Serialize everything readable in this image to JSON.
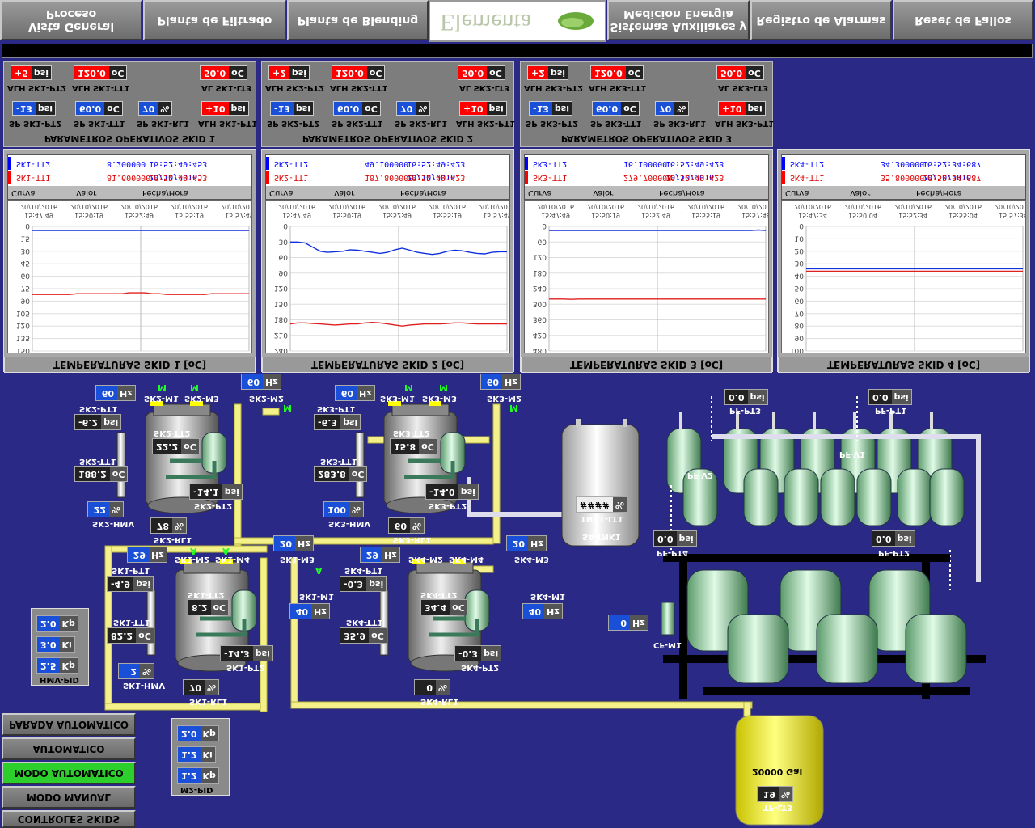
{
  "nav": {
    "items": [
      "Vista General Proceso",
      "Planta de Filtrado",
      "Planta de Blending",
      "Sistemas Auxiliares y Medicion Energia",
      "Registro de Alarmas",
      "Reset de Fallos"
    ],
    "logo_text": "Elementa"
  },
  "skids_params": [
    {
      "title": "PARAMETROS OPERATIVOS SKID 1",
      "alh_pt2": "+5",
      "alh_pt2_u": "psi",
      "alh_tt1": "120.0",
      "alh_tt1_u": "oC",
      "al_lt3": "50.0",
      "al_lt3_u": "oC",
      "lbl_alh_pt2": "ALH SK1-PT2",
      "lbl_alh_tt1": "ALH SK1-TT1",
      "lbl_al_lt3": "AL SK1-LT3",
      "sp_pt2": "-13",
      "sp_pt2_u": "psi",
      "sp_tt1": "60.0",
      "sp_tt1_u": "oC",
      "sp_rl1": "70",
      "sp_rl1_u": "%",
      "alh_pt1": "+10",
      "alh_pt1_u": "psi",
      "lbl_sp_pt2": "SP SK1-PT2",
      "lbl_sp_tt1": "SP SK1-TT1",
      "lbl_sp_rl1": "SP SK1-RL1",
      "lbl_alh_pt1": "ALH SK1-PT1"
    },
    {
      "title": "PARAMETROS OPERATIVOS SKID 2",
      "alh_pt2": "+2",
      "alh_pt2_u": "psi",
      "alh_tt1": "120.0",
      "alh_tt1_u": "oC",
      "al_lt3": "50.0",
      "al_lt3_u": "oC",
      "lbl_alh_pt2": "ALH SK2-PT2",
      "lbl_alh_tt1": "ALH SK2-TT1",
      "lbl_al_lt3": "AL SK2-LT3",
      "sp_pt2": "-13",
      "sp_pt2_u": "psi",
      "sp_tt1": "60.0",
      "sp_tt1_u": "oC",
      "sp_rl1": "70",
      "sp_rl1_u": "%",
      "alh_pt1": "+10",
      "alh_pt1_u": "psi",
      "lbl_sp_pt2": "SP SK2-PT2",
      "lbl_sp_tt1": "SP SK2-TT1",
      "lbl_sp_rl1": "SP SK2-RL1",
      "lbl_alh_pt1": "ALH SK2-PT1"
    },
    {
      "title": "PARAMETROS OPERATIVOS SKID 3",
      "alh_pt2": "+2",
      "alh_pt2_u": "psi",
      "alh_tt1": "120.0",
      "alh_tt1_u": "oC",
      "al_lt3": "50.0",
      "al_lt3_u": "oC",
      "lbl_alh_pt2": "ALH SK3-PT2",
      "lbl_alh_tt1": "ALH SK3-TT1",
      "lbl_al_lt3": "AL SK3-LT3",
      "sp_pt2": "-13",
      "sp_pt2_u": "psi",
      "sp_tt1": "60.0",
      "sp_tt1_u": "oC",
      "sp_rl1": "70",
      "sp_rl1_u": "%",
      "alh_pt1": "+10",
      "alh_pt1_u": "psi",
      "lbl_sp_pt2": "SP SK3-PT2",
      "lbl_sp_tt1": "SP SK3-TT1",
      "lbl_sp_rl1": "SP SK3-RL1",
      "lbl_alh_pt1": "ALH SK3-PT1"
    }
  ],
  "trends": [
    {
      "footer": "TEMPERATURAS SKID 1 [oC]",
      "row1": {
        "name": "SK1-TT2",
        "value": "8.200000",
        "time": "20/10/2016 16:52:49:453"
      },
      "row2": {
        "name": "SK1-TT1",
        "value": "81.600000",
        "time": "20/10/2016 16:52:49:453"
      },
      "hdr": [
        "Curva",
        "Valor",
        "Fecha/Hora"
      ],
      "xticks": [
        "20/10/2016\n15:47:49",
        "20/10/2016\n15:50:19",
        "20/10/2016\n15:52:49",
        "20/10/2016\n15:55:19",
        "20/10/2016\n15:57:49"
      ],
      "yticks": [
        "0",
        "15",
        "30",
        "45",
        "60",
        "75",
        "90",
        "105",
        "120",
        "135",
        "150"
      ],
      "ymax": 150,
      "blue": [
        5,
        5,
        5,
        5,
        5,
        5,
        5,
        5,
        5,
        5,
        5,
        5,
        5,
        5,
        5,
        5,
        5,
        5,
        5,
        5,
        5,
        5,
        5,
        5,
        5,
        5,
        5,
        5,
        5,
        5
      ],
      "red": [
        82,
        82,
        82,
        82,
        82,
        82,
        81,
        81,
        81,
        81,
        81,
        81,
        81,
        80,
        80,
        80,
        81,
        81,
        82,
        82,
        82,
        82,
        82,
        82,
        81,
        81,
        81,
        81,
        81,
        81
      ]
    },
    {
      "footer": "TEMPERATURAS SKID 2 [oC]",
      "row1": {
        "name": "SK2-TT2",
        "value": "49.100000",
        "time": "20/10/2016 16:52:49:423"
      },
      "row2": {
        "name": "SK2-TT1",
        "value": "187.800000",
        "time": "20/10/2016 16:52:49:423"
      },
      "hdr": [
        "Curva",
        "Valor",
        "Fecha/Hora"
      ],
      "xticks": [
        "20/10/2016\n15:47:49",
        "20/10/2016\n15:50:19",
        "20/10/2016\n15:52:49",
        "20/10/2016\n15:55:19",
        "20/10/2016\n15:57:49"
      ],
      "yticks": [
        "0",
        "30",
        "60",
        "90",
        "120",
        "150",
        "180",
        "210",
        "240"
      ],
      "ymax": 240,
      "blue": [
        30,
        30,
        32,
        40,
        48,
        50,
        49,
        48,
        45,
        46,
        48,
        50,
        52,
        50,
        45,
        42,
        46,
        50,
        52,
        54,
        52,
        48,
        46,
        47,
        50,
        52,
        53,
        50,
        49,
        49
      ],
      "red": [
        188,
        186,
        186,
        187,
        188,
        189,
        190,
        189,
        188,
        188,
        186,
        185,
        186,
        188,
        190,
        192,
        190,
        189,
        188,
        188,
        188,
        187,
        186,
        186,
        187,
        188,
        188,
        188,
        188,
        188
      ]
    },
    {
      "footer": "TEMPERATURAS SKID 3 [oC]",
      "row1": {
        "name": "SK3-TT2",
        "value": "16.100000",
        "time": "20/10/2016 16:52:49:423"
      },
      "row2": {
        "name": "SK3-TT1",
        "value": "279.700000",
        "time": "20/10/2016 16:52:49:423"
      },
      "hdr": [
        "Curva",
        "Valor",
        "Fecha/Hora"
      ],
      "xticks": [
        "20/10/2016\n15:47:49",
        "20/10/2016\n15:50:19",
        "20/10/2016\n15:52:49",
        "20/10/2016\n15:55:19",
        "20/10/2016\n15:57:49"
      ],
      "yticks": [
        "0",
        "60",
        "120",
        "180",
        "240",
        "300",
        "360",
        "420",
        "480"
      ],
      "ymax": 480,
      "blue": [
        16,
        16,
        16,
        16,
        16,
        16,
        16,
        16,
        16,
        16,
        16,
        16,
        16,
        16,
        16,
        16,
        16,
        16,
        16,
        16,
        16,
        16,
        16,
        16,
        16,
        16,
        16,
        16,
        14,
        16
      ],
      "red": [
        280,
        280,
        280,
        281,
        280,
        280,
        280,
        280,
        280,
        280,
        280,
        280,
        280,
        280,
        280,
        280,
        280,
        280,
        280,
        280,
        280,
        280,
        280,
        280,
        280,
        280,
        280,
        280,
        280,
        280
      ]
    },
    {
      "footer": "TEMPERATURAS SKID 4 [oC]",
      "row1": {
        "name": "SK4-TT2",
        "value": "34.300000",
        "time": "20/10/2016 16:52:34:687"
      },
      "row2": {
        "name": "SK4-TT1",
        "value": "35.800000",
        "time": "20/10/2016 16:52:34:687"
      },
      "hdr": [
        "Curva",
        "Valor",
        "Fecha/Hora"
      ],
      "xticks": [
        "20/10/2016\n15:47:34",
        "20/10/2016\n15:50:04",
        "20/10/2016\n15:52:34",
        "20/10/2016\n15:55:04",
        "20/10/2016\n15:57:34"
      ],
      "yticks": [
        "0",
        "10",
        "20",
        "30",
        "40",
        "50",
        "60",
        "70",
        "80",
        "90",
        "100"
      ],
      "ymax": 100,
      "blue": [
        34,
        34,
        34,
        34,
        34,
        34,
        34,
        34,
        34,
        34,
        34,
        34,
        34,
        34,
        34,
        34,
        34,
        34,
        34,
        34,
        34,
        34,
        34,
        34,
        34,
        34,
        34,
        34,
        34,
        34
      ],
      "red": [
        36,
        36,
        36,
        36,
        36,
        36,
        36,
        36,
        36,
        36,
        36,
        36,
        36,
        36,
        36,
        36,
        36,
        36,
        36,
        36,
        36,
        36,
        36,
        36,
        36,
        36,
        36,
        36,
        36,
        36
      ]
    }
  ],
  "process": {
    "sk2": {
      "m1_hz": "60",
      "m1_u": "Hz",
      "m2_hz": "60",
      "m2_u": "Hz",
      "pt1": "-6.2",
      "pt1_u": "psi",
      "tt2": "22.2",
      "tt2_u": "oC",
      "tt1": "188.2",
      "tt1_u": "oC",
      "pt2": "-14.1",
      "pt2_u": "psi",
      "hmv": "22",
      "hmv_u": "%",
      "rl1": "78",
      "rl1_u": "%",
      "labels": {
        "pt1": "SK2-PT1",
        "m1": "SK2-M1",
        "m3": "SK2-M3",
        "m2": "SK2-M2",
        "tt2": "SK2-TT2",
        "tt1": "SK2-TT1",
        "pt2": "SK2-PT2",
        "hmv": "SK2-HMV",
        "rl1": "SK2-RL1"
      },
      "m1_state": "M",
      "m3_state": "M",
      "m2_state": "M"
    },
    "sk3": {
      "m1_hz": "60",
      "m1_u": "Hz",
      "m2_hz": "60",
      "m2_u": "Hz",
      "pt1": "-6.3",
      "pt1_u": "psi",
      "tt2": "15.8",
      "tt2_u": "oC",
      "tt1": "283.8",
      "tt1_u": "oC",
      "pt2": "-14.0",
      "pt2_u": "psi",
      "hmv": "100",
      "hmv_u": "%",
      "rl1": "60",
      "rl1_u": "%",
      "labels": {
        "pt1": "SK3-PT1",
        "m1": "SK3-M1",
        "m3": "SK3-M3",
        "m2": "SK3-M2",
        "tt2": "SK3-TT2",
        "tt1": "SK3-TT1",
        "pt2": "SK3-PT2",
        "hmv": "SK3-HMV",
        "rl1": "SK3-RL1"
      }
    },
    "sk1": {
      "m1_hz": "40",
      "m1_u": "Hz",
      "m2_hz": "29",
      "m2_u": "Hz",
      "m3_hz": "20",
      "m3_u": "Hz",
      "pt1": "-4.9",
      "pt1_u": "psi",
      "tt2": "8.2",
      "tt2_u": "oC",
      "tt1": "82.2",
      "tt1_u": "oC",
      "pt2": "-14.3",
      "pt2_u": "psi",
      "hmv": "2",
      "hmv_u": "%",
      "rl1": "70",
      "rl1_u": "%",
      "labels": {
        "pt1": "SK1-PT1",
        "m2": "SK1-M2",
        "m4": "SK1-M4",
        "m3": "SK1-M3",
        "m1": "SK1-M1",
        "tt2": "SK1-TT2",
        "tt1": "SK1-TT1",
        "pt2": "SK1-PT2",
        "hmv": "SK1-HMV",
        "rl1": "SK1-RL1"
      },
      "m2_state": "A",
      "m1_state": "A"
    },
    "sk4": {
      "m2_hz": "29",
      "m2_u": "Hz",
      "m3_hz": "20",
      "m3_u": "Hz",
      "m1_hz": "40",
      "m1_u": "Hz",
      "pt1": "-0.3",
      "pt1_u": "psi",
      "tt2": "34.4",
      "tt2_u": "oC",
      "tt1": "35.9",
      "tt1_u": "oC",
      "pt2": "-0.3",
      "pt2_u": "psi",
      "rl1": "0",
      "rl1_u": "%",
      "labels": {
        "pt1": "SK4-PT1",
        "m2": "SK4-M2",
        "m4": "SK4-M4",
        "m3": "SK4-M3",
        "m1": "SK4-M1",
        "tt2": "SK4-TT2",
        "tt1": "SK4-TT1",
        "pt2": "SK4-PT2",
        "rl1": "SK4-RL1"
      }
    },
    "tank": {
      "lt1": "####",
      "lt1_u": "%",
      "label": "SA-TNK1",
      "lt1_label": "TNK1-LT1"
    },
    "pf": {
      "pt3": "0.0",
      "pt3_u": "psi",
      "pt1": "0.0",
      "pt1_u": "psi",
      "pt4": "0.0",
      "pt4_u": "psi",
      "pt2": "0.0",
      "pt2_u": "psi",
      "lbl_pt3": "PF-PT3",
      "lbl_pt1": "PF-PT1",
      "lbl_pt4": "PF-PT4",
      "lbl_pt2": "PF-PT2",
      "lbl_v2": "PF-V2",
      "lbl_v1": "PF-V1"
    },
    "cf": {
      "hz": "0",
      "u": "Hz",
      "label": "CF-M1"
    },
    "tf": {
      "lt3": "19",
      "lt3_u": "%",
      "cap": "20000 Gal",
      "label": "TF-LT3"
    },
    "hmv_pid": {
      "kp": "2.0",
      "kp_u": "Kp",
      "ki": "3.0",
      "ki_u": "Ki",
      "kd": "2.5",
      "kd_u": "Kp",
      "label": "HMV-PID"
    },
    "m2_pid": {
      "kp": "2.0",
      "kp_u": "Kp",
      "ki": "1.2",
      "ki_u": "Ki",
      "kd": "1.2",
      "kd_u": "Kp",
      "label": "M2-PID"
    }
  },
  "buttons": {
    "parada": "PARADA AUTOMATICO",
    "arranque": "ARRANQUE AUTOMATICO",
    "auto": "MODO AUTOMATICO",
    "manual": "MODO MANUAL",
    "controles": "CONTROLES SKIDS"
  },
  "colors": {
    "background": "#2a2a86",
    "pipe": "#f4f08a",
    "alarm": "#ff0000",
    "setpoint": "#1a50d8",
    "auto_button": "#2dcf2d"
  }
}
